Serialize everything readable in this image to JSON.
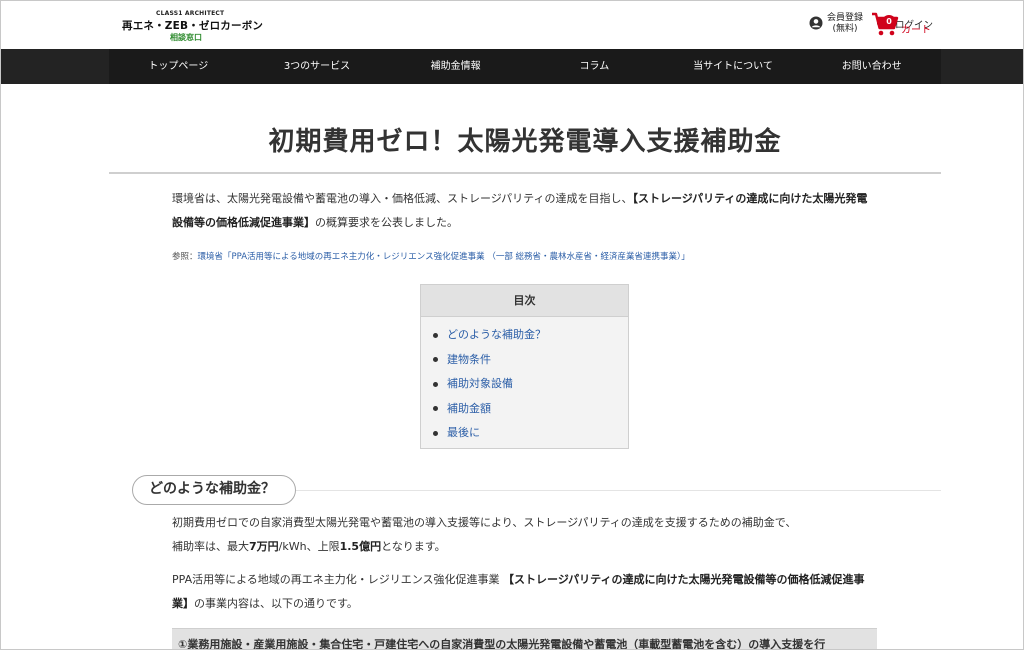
{
  "header": {
    "logo_top": "CLASS1 ARCHITECT",
    "logo_main": "再エネ・ZEB・ゼロカーボン",
    "logo_sub": "相談窓口",
    "member_line1": "会員登録",
    "member_line2": "(無料)",
    "login": "ログイン",
    "cart_count": "0",
    "cart": "カート"
  },
  "nav": {
    "items": [
      "トップページ",
      "3つのサービス",
      "補助金情報",
      "コラム",
      "当サイトについて",
      "お問い合わせ"
    ]
  },
  "main": {
    "title": "初期費用ゼロ！太陽光発電導入支援補助金",
    "intro_text": "環境省は、太陽光発電設備や蓄電池の導入・価格低減、ストレージパリティの達成を目指し、",
    "intro_bold": "【ストレージパリティの達成に向けた太陽光発電設備等の価格低減促進事業】",
    "intro_tail": "の概算要求を公表しました。",
    "ref_prefix": "参照：",
    "ref_link": "環境省「PPA活用等による地域の再エネ主力化・レジリエンス強化促進事業 （一部 総務省・農林水産省・経済産業省連携事業）」",
    "toc_title": "目次",
    "toc_items": [
      "どのような補助金？",
      "建物条件",
      "補助対象設備",
      "補助金額",
      "最後に"
    ],
    "section1_title": "どのような補助金？",
    "s1_p1_a": "初期費用ゼロでの自家消費型太陽光発電や蓄電池の導入支援等により、ストレージパリティの達成を支援するための補助金で、",
    "s1_p1_b": "補助率は、最大",
    "s1_p1_b_bold1": "7万円",
    "s1_p1_b_mid": "/kWh、上限",
    "s1_p1_b_bold2": "1.5億円",
    "s1_p1_b_tail": "となります。",
    "s1_p2_a": "PPA活用等による地域の再エネ主力化・レジリエンス強化促進事業 ",
    "s1_p2_bold": "【ストレージパリティの達成に向けた太陽光発電設備等の価格低減促進事業】",
    "s1_p2_tail": "の事業内容は、以下の通りです。",
    "box_text": "①業務用施設・産業用施設・集合住宅・戸建住宅への自家消費型の太陽光発電設備や蓄電池（車載型蓄電池を含む）の導入支援を行"
  },
  "colors": {
    "nav_bg": "#1a1a1a",
    "link": "#2b5ea7",
    "cart_red": "#d0021b",
    "logo_green": "#2e8b2e"
  }
}
